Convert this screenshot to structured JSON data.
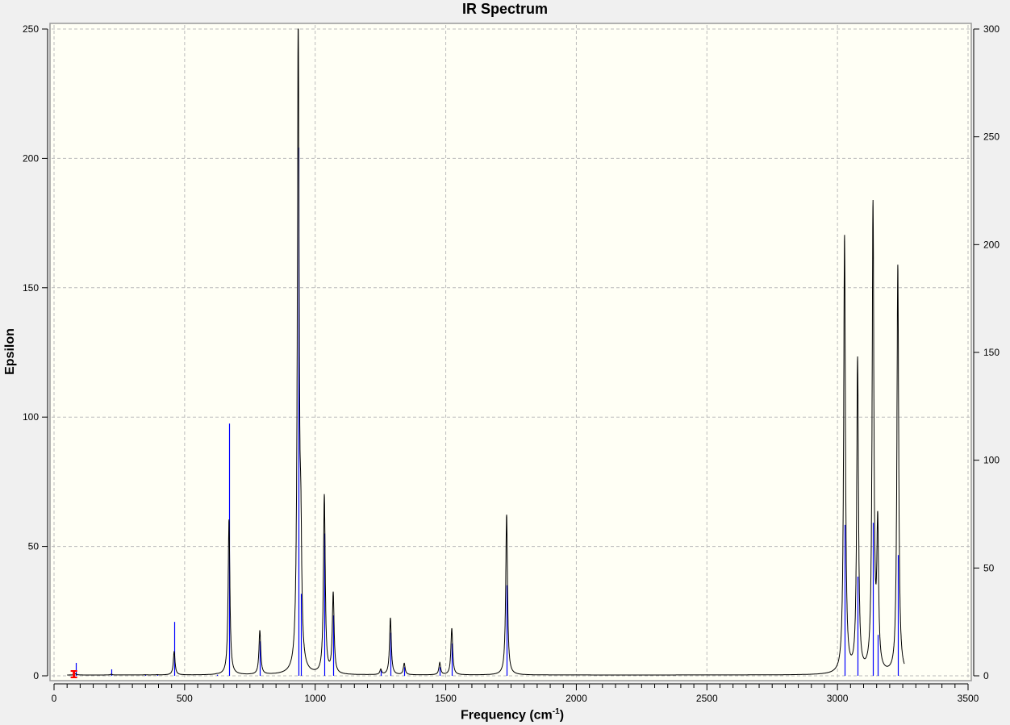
{
  "chart_data": {
    "type": "line",
    "title": "IR Spectrum",
    "xlabel": "Frequency (cm",
    "xlabel_sup": "-1",
    "ylabel": "Epsilon",
    "xlim": [
      0,
      3500
    ],
    "ylim": [
      0,
      250
    ],
    "y2lim": [
      0,
      300
    ],
    "x_ticks": [
      "0",
      "500",
      "1000",
      "1500",
      "2000",
      "2500",
      "3000",
      "3500"
    ],
    "y_ticks": [
      "0",
      "50",
      "100",
      "150",
      "200",
      "250"
    ],
    "y2_ticks": [
      "0",
      "50",
      "100",
      "150",
      "200",
      "250",
      "300"
    ],
    "grid": true,
    "colors": {
      "spectrum": "#000000",
      "sticks": "#0000ff",
      "marker": "#ff0000",
      "plot_bg": "#fffff5"
    },
    "peaks": [
      {
        "freq": 83,
        "epsilon": 0.5,
        "intensity": 6
      },
      {
        "freq": 219,
        "epsilon": 0.3,
        "intensity": 3
      },
      {
        "freq": 349,
        "epsilon": 0.1,
        "intensity": 0.5
      },
      {
        "freq": 395,
        "epsilon": 0.1,
        "intensity": 0.5
      },
      {
        "freq": 460,
        "epsilon": 9,
        "intensity": 25
      },
      {
        "freq": 623,
        "epsilon": 0.1,
        "intensity": 0.5
      },
      {
        "freq": 670,
        "epsilon": 60,
        "intensity": 117
      },
      {
        "freq": 788,
        "epsilon": 17,
        "intensity": 16
      },
      {
        "freq": 935,
        "epsilon": 249,
        "intensity": 245
      },
      {
        "freq": 945,
        "epsilon": 40,
        "intensity": 38
      },
      {
        "freq": 1035,
        "epsilon": 69,
        "intensity": 66
      },
      {
        "freq": 1069,
        "epsilon": 31,
        "intensity": 28
      },
      {
        "freq": 1251,
        "epsilon": 2,
        "intensity": 2.6
      },
      {
        "freq": 1288,
        "epsilon": 22,
        "intensity": 20
      },
      {
        "freq": 1341,
        "epsilon": 4.4,
        "intensity": 4
      },
      {
        "freq": 1477,
        "epsilon": 4.7,
        "intensity": 4
      },
      {
        "freq": 1523,
        "epsilon": 18,
        "intensity": 15
      },
      {
        "freq": 1733,
        "epsilon": 62,
        "intensity": 42
      },
      {
        "freq": 3027,
        "epsilon": 169,
        "intensity": 70
      },
      {
        "freq": 3077,
        "epsilon": 121,
        "intensity": 46
      },
      {
        "freq": 3136,
        "epsilon": 180,
        "intensity": 71
      },
      {
        "freq": 3154,
        "epsilon": 54,
        "intensity": 19
      },
      {
        "freq": 3231,
        "epsilon": 158,
        "intensity": 56
      }
    ],
    "marker_freq": 76
  }
}
